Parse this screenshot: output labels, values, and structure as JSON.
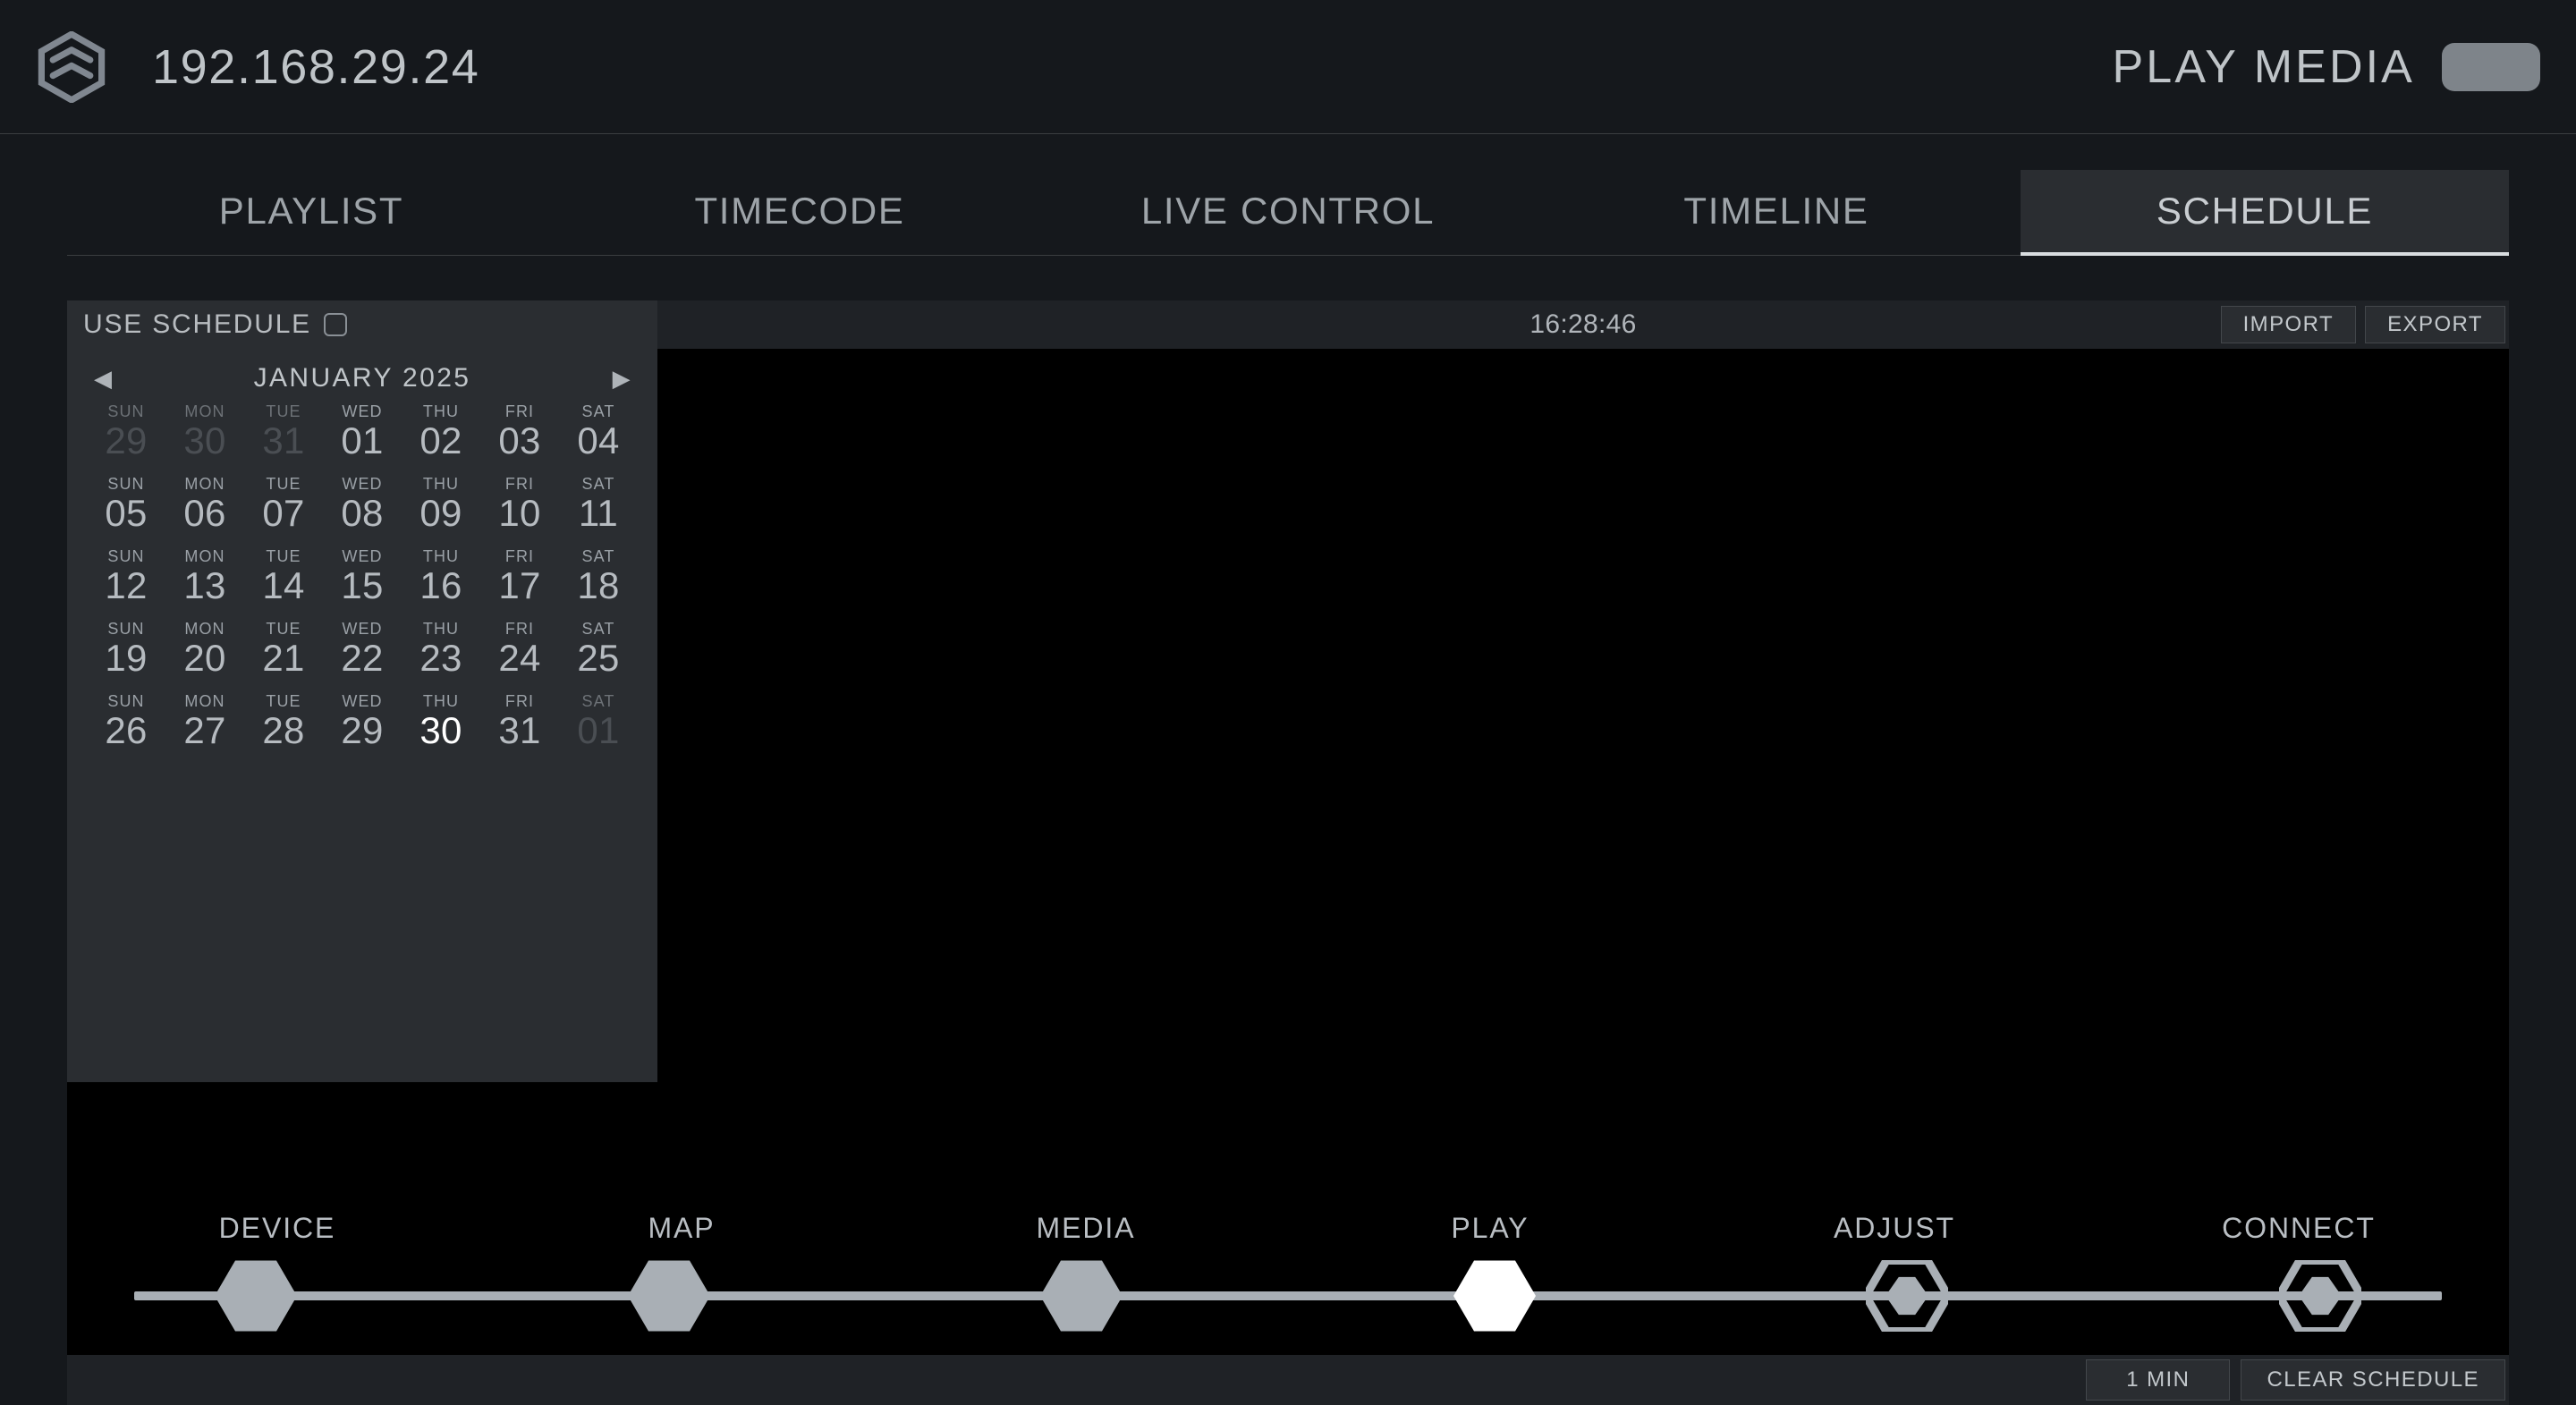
{
  "header": {
    "ip": "192.168.29.24",
    "title": "PLAY MEDIA"
  },
  "tabs": [
    {
      "id": "playlist",
      "label": "PLAYLIST",
      "active": false
    },
    {
      "id": "timecode",
      "label": "TIMECODE",
      "active": false
    },
    {
      "id": "livecontrol",
      "label": "LIVE CONTROL",
      "active": false
    },
    {
      "id": "timeline",
      "label": "TIMELINE",
      "active": false
    },
    {
      "id": "schedule",
      "label": "SCHEDULE",
      "active": true
    }
  ],
  "schedule": {
    "use_schedule_label": "USE SCHEDULE",
    "use_schedule_checked": false,
    "clock": "16:28:46",
    "import_label": "IMPORT",
    "export_label": "EXPORT",
    "zoom_label": "1 MIN",
    "clear_label": "CLEAR SCHEDULE",
    "calendar": {
      "month_label": "JANUARY 2025",
      "dow": [
        "SUN",
        "MON",
        "TUE",
        "WED",
        "THU",
        "FRI",
        "SAT"
      ],
      "weeks": [
        [
          {
            "n": "29",
            "dim": true
          },
          {
            "n": "30",
            "dim": true
          },
          {
            "n": "31",
            "dim": true
          },
          {
            "n": "01"
          },
          {
            "n": "02"
          },
          {
            "n": "03"
          },
          {
            "n": "04"
          }
        ],
        [
          {
            "n": "05"
          },
          {
            "n": "06"
          },
          {
            "n": "07"
          },
          {
            "n": "08"
          },
          {
            "n": "09"
          },
          {
            "n": "10"
          },
          {
            "n": "11"
          }
        ],
        [
          {
            "n": "12"
          },
          {
            "n": "13"
          },
          {
            "n": "14"
          },
          {
            "n": "15"
          },
          {
            "n": "16"
          },
          {
            "n": "17"
          },
          {
            "n": "18"
          }
        ],
        [
          {
            "n": "19"
          },
          {
            "n": "20"
          },
          {
            "n": "21"
          },
          {
            "n": "22"
          },
          {
            "n": "23"
          },
          {
            "n": "24"
          },
          {
            "n": "25"
          }
        ],
        [
          {
            "n": "26"
          },
          {
            "n": "27"
          },
          {
            "n": "28"
          },
          {
            "n": "29"
          },
          {
            "n": "30",
            "today": true
          },
          {
            "n": "31"
          },
          {
            "n": "01",
            "dim": true
          }
        ]
      ]
    }
  },
  "stepper": [
    {
      "id": "device",
      "label": "DEVICE",
      "style": "solid",
      "active": false
    },
    {
      "id": "map",
      "label": "MAP",
      "style": "solid",
      "active": false
    },
    {
      "id": "media",
      "label": "MEDIA",
      "style": "solid",
      "active": false
    },
    {
      "id": "play",
      "label": "PLAY",
      "style": "solid",
      "active": true
    },
    {
      "id": "adjust",
      "label": "ADJUST",
      "style": "outline",
      "active": false
    },
    {
      "id": "connect",
      "label": "CONNECT",
      "style": "outline",
      "active": false
    }
  ],
  "colors": {
    "bg": "#15181c",
    "panel": "#2a2d31",
    "panel2": "#1f2226",
    "text": "#b8bcc0",
    "accent": "#a9afb5"
  }
}
